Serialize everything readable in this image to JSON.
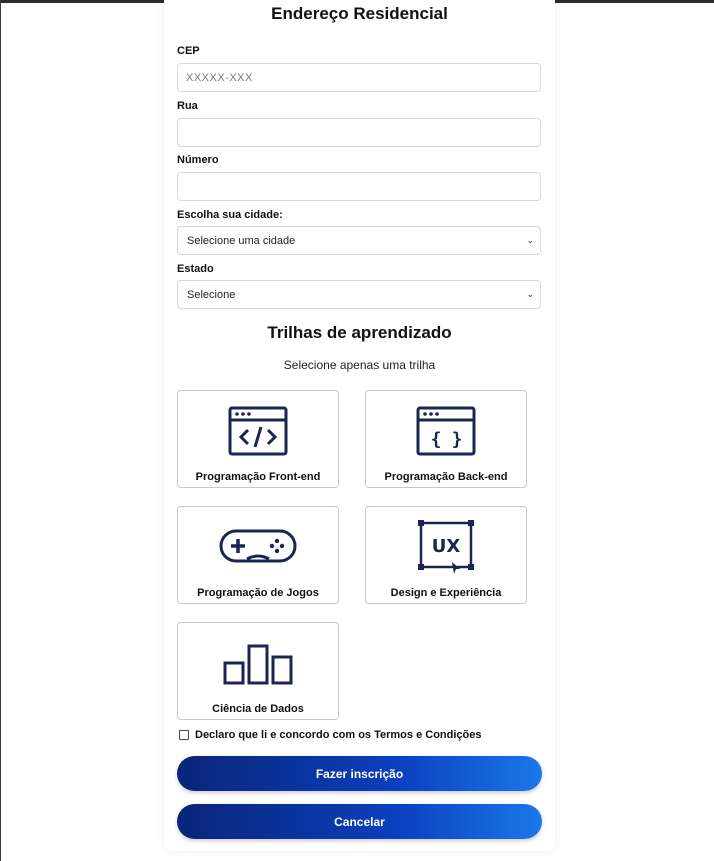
{
  "address": {
    "title": "Endereço Residencial",
    "cep": {
      "label": "CEP",
      "placeholder": "XXXXX-XXX",
      "value": ""
    },
    "rua": {
      "label": "Rua",
      "value": ""
    },
    "numero": {
      "label": "Número",
      "value": ""
    },
    "cidade": {
      "label": "Escolha sua cidade:",
      "selected": "Selecione uma cidade"
    },
    "estado": {
      "label": "Estado",
      "selected": "Selecione"
    }
  },
  "trilhas": {
    "title": "Trilhas de aprendizado",
    "subtitle": "Selecione apenas uma trilha",
    "items": [
      {
        "label": "Programação Front-end",
        "icon": "code-window-icon"
      },
      {
        "label": "Programação Back-end",
        "icon": "braces-window-icon"
      },
      {
        "label": "Programação de Jogos",
        "icon": "gamepad-icon"
      },
      {
        "label": "Design e Experiência",
        "icon": "ux-frame-icon"
      },
      {
        "label": "Ciência de Dados",
        "icon": "bar-chart-icon"
      }
    ]
  },
  "terms": {
    "label": "Declaro que li e concordo com os Termos e Condições",
    "checked": false
  },
  "actions": {
    "submit": "Fazer inscrição",
    "cancel": "Cancelar"
  },
  "colors": {
    "icon": "#1c2550",
    "button_start": "#0a2577",
    "button_end": "#1b78e8"
  }
}
